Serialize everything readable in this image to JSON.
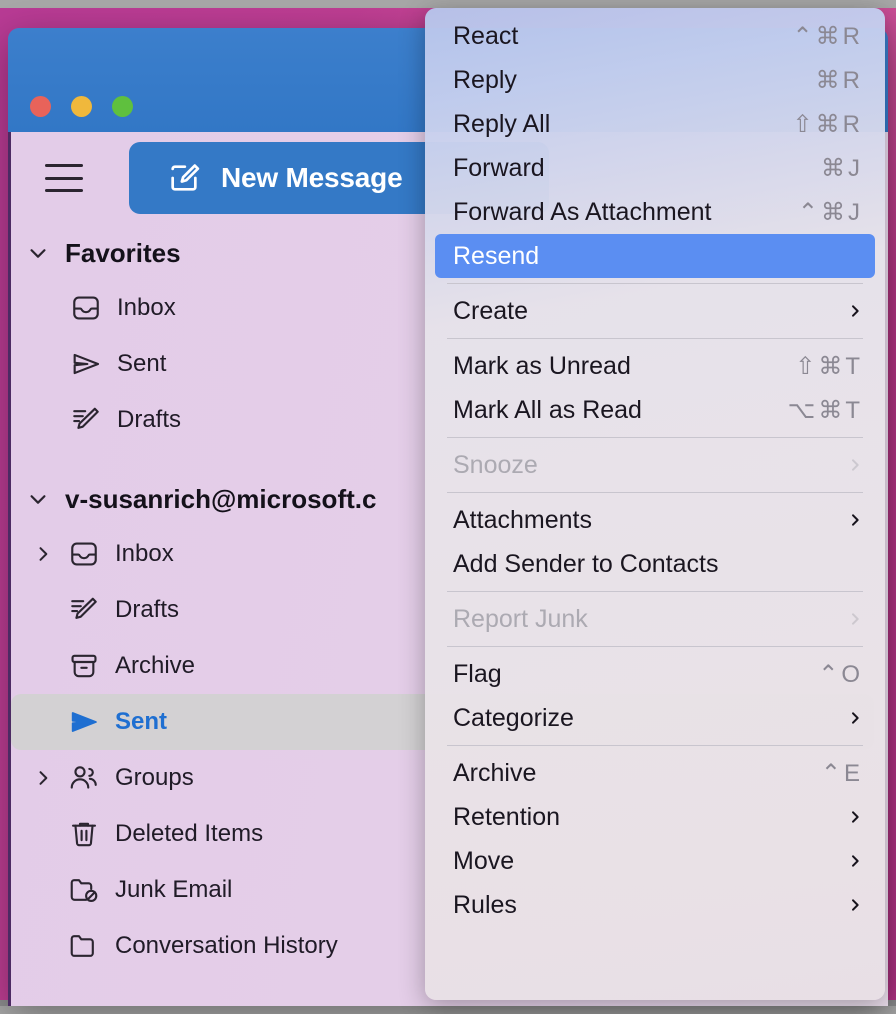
{
  "window": {
    "traffic_lights": [
      "close",
      "minimize",
      "zoom"
    ],
    "colors": {
      "titlebar": "#3479c6",
      "accent": "#1f6fd1",
      "highlight": "#5b8ef2",
      "sidebar": "#e4cee8"
    }
  },
  "toolbar": {
    "hamburger_label": "sidebar-toggle",
    "new_message_label": "New Message"
  },
  "sidebar": {
    "favorites": {
      "title": "Favorites",
      "expanded": true,
      "items": [
        {
          "label": "Inbox",
          "icon": "inbox-icon"
        },
        {
          "label": "Sent",
          "icon": "send-icon"
        },
        {
          "label": "Drafts",
          "icon": "draft-pencil-icon"
        }
      ]
    },
    "account": {
      "title": "v-susanrich@microsoft.c",
      "expanded": true,
      "items": [
        {
          "label": "Inbox",
          "icon": "inbox-icon",
          "expandable": true,
          "selected": false
        },
        {
          "label": "Drafts",
          "icon": "draft-pencil-icon",
          "expandable": false,
          "selected": false
        },
        {
          "label": "Archive",
          "icon": "archive-box-icon",
          "expandable": false,
          "selected": false
        },
        {
          "label": "Sent",
          "icon": "send-icon",
          "expandable": false,
          "selected": true
        },
        {
          "label": "Groups",
          "icon": "people-icon",
          "expandable": true,
          "selected": false
        },
        {
          "label": "Deleted Items",
          "icon": "trash-icon",
          "expandable": false,
          "selected": false
        },
        {
          "label": "Junk Email",
          "icon": "folder-blocked-icon",
          "expandable": false,
          "selected": false
        },
        {
          "label": "Conversation History",
          "icon": "folder-icon",
          "expandable": false,
          "selected": false
        }
      ]
    }
  },
  "context_menu": {
    "groups": [
      {
        "items": [
          {
            "label": "React",
            "shortcut": "⌃⌘R",
            "submenu": false,
            "disabled": false,
            "highlighted": false
          },
          {
            "label": "Reply",
            "shortcut": "⌘R",
            "submenu": false,
            "disabled": false,
            "highlighted": false
          },
          {
            "label": "Reply All",
            "shortcut": "⇧⌘R",
            "submenu": false,
            "disabled": false,
            "highlighted": false
          },
          {
            "label": "Forward",
            "shortcut": "⌘J",
            "submenu": false,
            "disabled": false,
            "highlighted": false
          },
          {
            "label": "Forward As Attachment",
            "shortcut": "⌃⌘J",
            "submenu": false,
            "disabled": false,
            "highlighted": false
          },
          {
            "label": "Resend",
            "shortcut": "",
            "submenu": false,
            "disabled": false,
            "highlighted": true
          }
        ]
      },
      {
        "items": [
          {
            "label": "Create",
            "shortcut": "",
            "submenu": true,
            "disabled": false,
            "highlighted": false
          }
        ]
      },
      {
        "items": [
          {
            "label": "Mark as Unread",
            "shortcut": "⇧⌘T",
            "submenu": false,
            "disabled": false,
            "highlighted": false
          },
          {
            "label": "Mark All as Read",
            "shortcut": "⌥⌘T",
            "submenu": false,
            "disabled": false,
            "highlighted": false
          }
        ]
      },
      {
        "items": [
          {
            "label": "Snooze",
            "shortcut": "",
            "submenu": true,
            "disabled": true,
            "highlighted": false
          }
        ]
      },
      {
        "items": [
          {
            "label": "Attachments",
            "shortcut": "",
            "submenu": true,
            "disabled": false,
            "highlighted": false
          },
          {
            "label": "Add Sender to Contacts",
            "shortcut": "",
            "submenu": false,
            "disabled": false,
            "highlighted": false
          }
        ]
      },
      {
        "items": [
          {
            "label": "Report Junk",
            "shortcut": "",
            "submenu": true,
            "disabled": true,
            "highlighted": false
          }
        ]
      },
      {
        "items": [
          {
            "label": "Flag",
            "shortcut": "⌃O",
            "submenu": false,
            "disabled": false,
            "highlighted": false
          },
          {
            "label": "Categorize",
            "shortcut": "",
            "submenu": true,
            "disabled": false,
            "highlighted": false
          }
        ]
      },
      {
        "items": [
          {
            "label": "Archive",
            "shortcut": "⌃E",
            "submenu": false,
            "disabled": false,
            "highlighted": false
          },
          {
            "label": "Retention",
            "shortcut": "",
            "submenu": true,
            "disabled": false,
            "highlighted": false
          },
          {
            "label": "Move",
            "shortcut": "",
            "submenu": true,
            "disabled": false,
            "highlighted": false
          },
          {
            "label": "Rules",
            "shortcut": "",
            "submenu": true,
            "disabled": false,
            "highlighted": false
          }
        ]
      }
    ]
  }
}
